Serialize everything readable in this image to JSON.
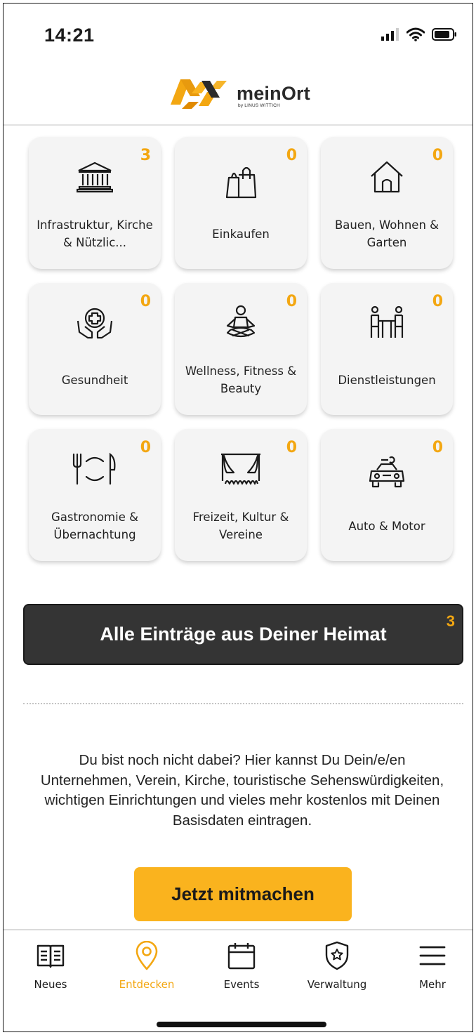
{
  "status": {
    "time": "14:21"
  },
  "header": {
    "logo_name": "meinOrt",
    "logo_sub": "by LINUS WITTICH"
  },
  "categories": [
    {
      "label": "Infrastruktur, Kirche & Nützlic...",
      "count": "3",
      "icon": "bank-icon"
    },
    {
      "label": "Einkaufen",
      "count": "0",
      "icon": "shopping-bag-icon"
    },
    {
      "label": "Bauen, Wohnen & Garten",
      "count": "0",
      "icon": "house-icon"
    },
    {
      "label": "Gesundheit",
      "count": "0",
      "icon": "health-hands-icon"
    },
    {
      "label": "Wellness, Fitness & Beauty",
      "count": "0",
      "icon": "meditation-icon"
    },
    {
      "label": "Dienstleistungen",
      "count": "0",
      "icon": "people-table-icon"
    },
    {
      "label": "Gastronomie & Übernachtung",
      "count": "0",
      "icon": "plate-cutlery-icon"
    },
    {
      "label": "Freizeit, Kultur & Vereine",
      "count": "0",
      "icon": "theater-stage-icon"
    },
    {
      "label": "Auto & Motor",
      "count": "0",
      "icon": "car-icon"
    }
  ],
  "all_entries": {
    "label": "Alle Einträge aus Deiner Heimat",
    "count": "3"
  },
  "promo": {
    "text": "Du bist noch nicht dabei? Hier kannst Du Dein/e/en Unternehmen, Verein, Kirche, touristische Sehenswürdigkeiten, wichtigen Einrichtungen und vieles mehr kostenlos mit Deinen Basisdaten eintragen."
  },
  "cta": {
    "label": "Jetzt mitmachen"
  },
  "tabs": [
    {
      "label": "Neues",
      "icon": "book-icon",
      "active": false
    },
    {
      "label": "Entdecken",
      "icon": "map-pin-icon",
      "active": true
    },
    {
      "label": "Events",
      "icon": "calendar-icon",
      "active": false
    },
    {
      "label": "Verwaltung",
      "icon": "shield-star-icon",
      "active": false
    },
    {
      "label": "Mehr",
      "icon": "menu-icon",
      "active": false
    }
  ],
  "colors": {
    "accent": "#f3a712",
    "cta": "#fab31e",
    "dark_bar": "#343434",
    "tile_bg": "#f4f4f4"
  }
}
